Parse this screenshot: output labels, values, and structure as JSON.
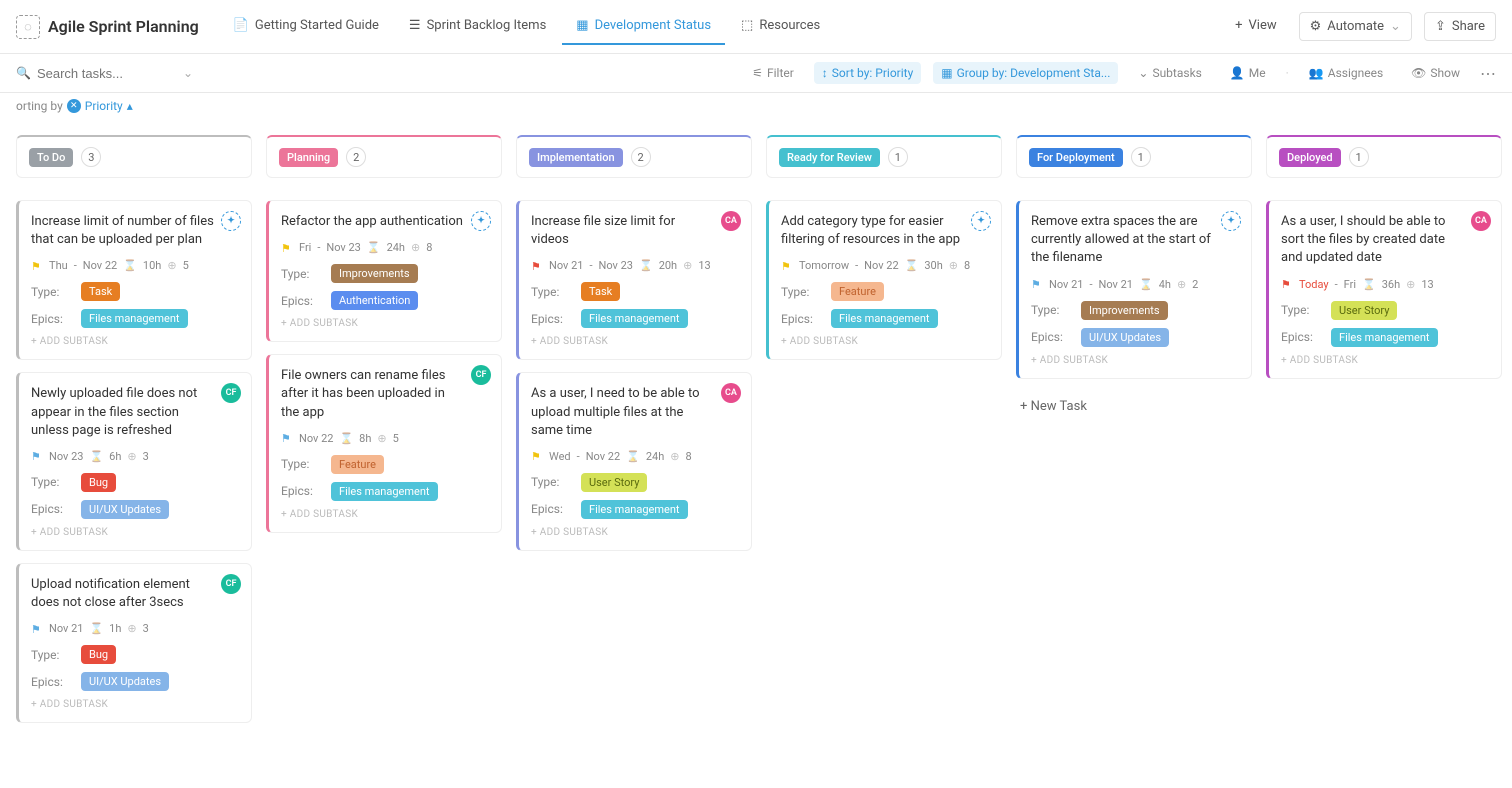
{
  "header": {
    "title": "Agile Sprint Planning",
    "tabs": [
      {
        "label": "Getting Started Guide",
        "active": false
      },
      {
        "label": "Sprint Backlog Items",
        "active": false
      },
      {
        "label": "Development Status",
        "active": true
      },
      {
        "label": "Resources",
        "active": false
      }
    ],
    "viewBtn": "View",
    "automate": "Automate",
    "share": "Share"
  },
  "toolbar": {
    "searchPlaceholder": "Search tasks...",
    "filter": "Filter",
    "sortBy": "Sort by: Priority",
    "groupBy": "Group by: Development Sta...",
    "subtasks": "Subtasks",
    "me": "Me",
    "assignees": "Assignees",
    "show": "Show"
  },
  "sortBar": {
    "prefix": "orting by",
    "field": "Priority"
  },
  "columns": [
    {
      "name": "To Do",
      "count": "3",
      "color": "#9aa0a6",
      "topColor": "#bdbdbd",
      "cards": [
        {
          "title": "Increase limit of number of files that can be uploaded per plan",
          "avatar": "dashed",
          "avatarText": "✦",
          "flag": "yellow",
          "date1": "Thu",
          "date2": "Nov 22",
          "hours": "10h",
          "count": "5",
          "type": {
            "text": "Task",
            "cls": "task"
          },
          "epic": {
            "text": "Files management",
            "cls": "files"
          },
          "addSub": "+ ADD SUBTASK"
        },
        {
          "title": "Newly uploaded file does not appear in the files section unless page is refreshed",
          "avatar": "teal",
          "avatarText": "CF",
          "flag": "cyan",
          "date1": "Nov 23",
          "date2": "",
          "hours": "6h",
          "count": "3",
          "type": {
            "text": "Bug",
            "cls": "bug"
          },
          "epic": {
            "text": "UI/UX Updates",
            "cls": "uiux"
          },
          "addSub": "+ ADD SUBTASK"
        },
        {
          "title": "Upload notification element does not close after 3secs",
          "avatar": "teal",
          "avatarText": "CF",
          "flag": "cyan",
          "date1": "Nov 21",
          "date2": "",
          "hours": "1h",
          "count": "3",
          "type": {
            "text": "Bug",
            "cls": "bug"
          },
          "epic": {
            "text": "UI/UX Updates",
            "cls": "uiux"
          },
          "addSub": "+ ADD SUBTASK"
        }
      ]
    },
    {
      "name": "Planning",
      "count": "2",
      "color": "#ec7599",
      "topColor": "#ec7599",
      "cards": [
        {
          "title": "Refactor the app authentication",
          "avatar": "dashed",
          "avatarText": "✦",
          "flag": "yellow",
          "date1": "Fri",
          "date2": "Nov 23",
          "hours": "24h",
          "count": "8",
          "type": {
            "text": "Improvements",
            "cls": "improvements"
          },
          "epic": {
            "text": "Authentication",
            "cls": "auth"
          },
          "addSub": "+ ADD SUBTASK"
        },
        {
          "title": "File owners can rename files after it has been uploaded in the app",
          "avatar": "teal",
          "avatarText": "CF",
          "flag": "cyan",
          "date1": "Nov 22",
          "date2": "",
          "hours": "8h",
          "count": "5",
          "type": {
            "text": "Feature",
            "cls": "feature"
          },
          "epic": {
            "text": "Files management",
            "cls": "files"
          },
          "addSub": "+ ADD SUBTASK"
        }
      ]
    },
    {
      "name": "Implementation",
      "count": "2",
      "color": "#8893e0",
      "topColor": "#8893e0",
      "cards": [
        {
          "title": "Increase file size limit for videos",
          "avatar": "pink",
          "avatarText": "CA",
          "flag": "red",
          "date1": "Nov 21",
          "date2": "Nov 23",
          "hours": "20h",
          "count": "13",
          "type": {
            "text": "Task",
            "cls": "task"
          },
          "epic": {
            "text": "Files management",
            "cls": "files"
          },
          "addSub": "+ ADD SUBTASK"
        },
        {
          "title": "As a user, I need to be able to upload multiple files at the same time",
          "avatar": "pink",
          "avatarText": "CA",
          "flag": "yellow",
          "date1": "Wed",
          "date2": "Nov 22",
          "hours": "24h",
          "count": "8",
          "type": {
            "text": "User Story",
            "cls": "userstory"
          },
          "epic": {
            "text": "Files management",
            "cls": "files"
          },
          "addSub": "+ ADD SUBTASK"
        }
      ]
    },
    {
      "name": "Ready for Review",
      "count": "1",
      "color": "#45c0cf",
      "topColor": "#45c0cf",
      "cards": [
        {
          "title": "Add category type for easier filtering of resources in the app",
          "avatar": "dashed",
          "avatarText": "✦",
          "flag": "yellow",
          "date1": "Tomorrow",
          "date2": "Nov 22",
          "hours": "30h",
          "count": "8",
          "type": {
            "text": "Feature",
            "cls": "feature"
          },
          "epic": {
            "text": "Files management",
            "cls": "files"
          },
          "addSub": "+ ADD SUBTASK"
        }
      ]
    },
    {
      "name": "For Deployment",
      "count": "1",
      "color": "#3b82e0",
      "topColor": "#3b82e0",
      "newTask": "+ New Task",
      "cards": [
        {
          "title": "Remove extra spaces the are currently allowed at the start of the filename",
          "avatar": "dashed",
          "avatarText": "✦",
          "flag": "cyan",
          "date1": "Nov 21",
          "date2": "Nov 21",
          "hours": "4h",
          "count": "2",
          "type": {
            "text": "Improvements",
            "cls": "improvements"
          },
          "epic": {
            "text": "UI/UX Updates",
            "cls": "uiux"
          },
          "addSub": "+ ADD SUBTASK"
        }
      ]
    },
    {
      "name": "Deployed",
      "count": "1",
      "color": "#b84fc1",
      "topColor": "#b84fc1",
      "cards": [
        {
          "title": "As a user, I should be able to sort the files by created date and updated date",
          "avatar": "pink",
          "avatarText": "CA",
          "flag": "red",
          "date1": "Today",
          "date2": "Fri",
          "hours": "36h",
          "count": "13",
          "dateRed": true,
          "type": {
            "text": "User Story",
            "cls": "userstory"
          },
          "epic": {
            "text": "Files management",
            "cls": "files"
          },
          "addSub": "+ ADD SUBTASK"
        }
      ]
    }
  ],
  "labels": {
    "type": "Type:",
    "epics": "Epics:"
  }
}
